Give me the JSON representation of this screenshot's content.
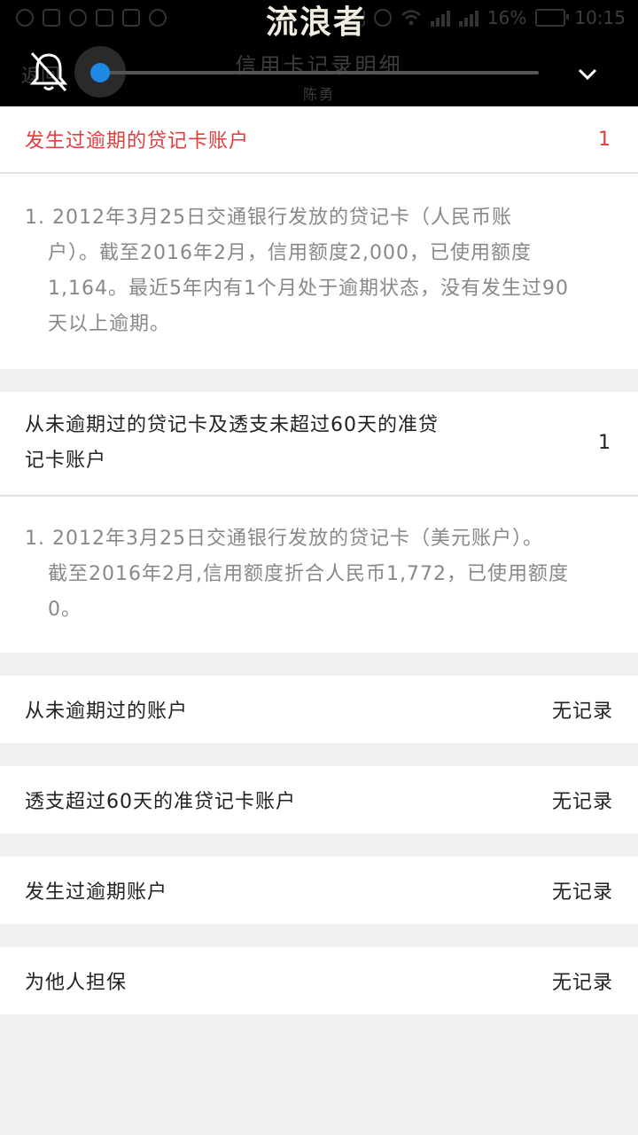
{
  "statusbar": {
    "battery_text": "16%",
    "time": "10:15"
  },
  "watermark": "流浪者",
  "header": {
    "title": "信用卡记录明细",
    "subtitle": "陈勇",
    "back_label": "返回"
  },
  "overdue_section": {
    "title": "发生过逾期的贷记卡账户",
    "count": "1",
    "title_color": "#e03c3c",
    "items": [
      {
        "line1": "1. 2012年3月25日交通银行发放的贷记卡（人民币账",
        "line2": "户）。截至2016年2月，信用额度2,000，已使用额度",
        "line3": "1,164。最近5年内有1个月处于逾期状态，没有发生过90",
        "line4": "天以上逾期。"
      }
    ]
  },
  "normal_section": {
    "title_line1": "从未逾期过的贷记卡及透支未超过60天的准贷",
    "title_line2": "记卡账户",
    "count": "1",
    "items": [
      {
        "line1": "1. 2012年3月25日交通银行发放的贷记卡（美元账户）。",
        "line2": "截至2016年2月,信用额度折合人民币1,772，已使用额度",
        "line3": "0。"
      }
    ]
  },
  "rows": [
    {
      "label": "从未逾期过的账户",
      "value": "无记录"
    },
    {
      "label": "透支超过60天的准贷记卡账户",
      "value": "无记录"
    },
    {
      "label": "发生过逾期账户",
      "value": "无记录"
    },
    {
      "label": "为他人担保",
      "value": "无记录"
    }
  ],
  "overlay": {
    "bell_icon": "bell-muted-icon",
    "chevron_icon": "chevron-down-icon",
    "accent": "#1e88e5",
    "volume_level": 0.0
  }
}
